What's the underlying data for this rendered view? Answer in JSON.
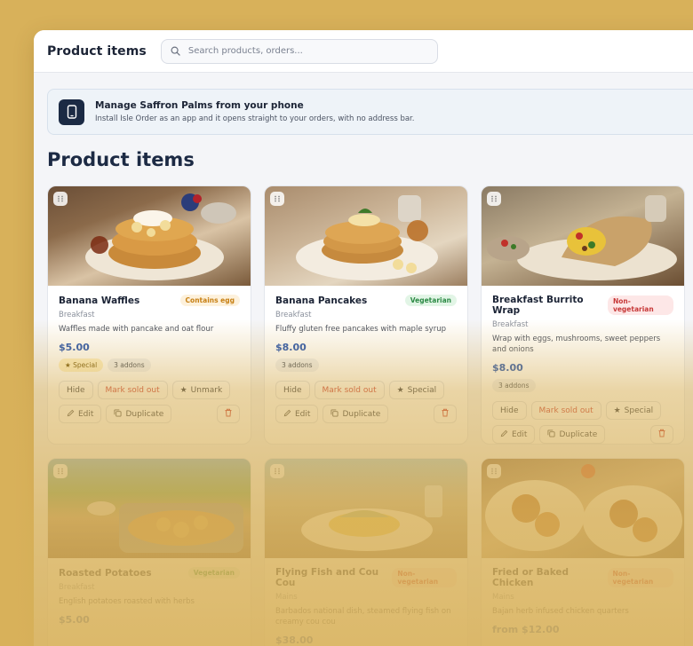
{
  "header": {
    "title": "Product items",
    "search_placeholder": "Search products, orders..."
  },
  "banner": {
    "title": "Manage Saffron Palms from your phone",
    "subtitle": "Install Isle Order as an app and it opens straight to your orders, with no address bar."
  },
  "page": {
    "title": "Product items"
  },
  "products": [
    {
      "name": "Banana Waffles",
      "tag": "Contains egg",
      "tag_type": "egg",
      "category": "Breakfast",
      "description": "Waffles made with pancake and oat flour",
      "price": "$5.00",
      "special_chip": "Special",
      "addons": "3 addons",
      "actions": {
        "hide": "Hide",
        "sold": "Mark sold out",
        "special": "Unmark",
        "edit": "Edit",
        "duplicate": "Duplicate"
      }
    },
    {
      "name": "Banana Pancakes",
      "tag": "Vegetarian",
      "tag_type": "veg",
      "category": "Breakfast",
      "description": "Fluffy gluten free pancakes with maple syrup",
      "price": "$8.00",
      "addons": "3 addons",
      "actions": {
        "hide": "Hide",
        "sold": "Mark sold out",
        "special": "Special",
        "edit": "Edit",
        "duplicate": "Duplicate"
      }
    },
    {
      "name": "Breakfast Burrito Wrap",
      "tag": "Non-vegetarian",
      "tag_type": "nonveg",
      "category": "Breakfast",
      "description": "Wrap with eggs, mushrooms, sweet peppers and onions",
      "price": "$8.00",
      "addons": "3 addons",
      "actions": {
        "hide": "Hide",
        "sold": "Mark sold out",
        "special": "Special",
        "edit": "Edit",
        "duplicate": "Duplicate"
      }
    },
    {
      "name": "Roasted Potatoes",
      "tag": "Vegetarian",
      "tag_type": "veg",
      "category": "Breakfast",
      "description": "English potatoes roasted with herbs",
      "price": "$5.00"
    },
    {
      "name": "Flying Fish and Cou Cou",
      "tag": "Non-vegetarian",
      "tag_type": "nonveg",
      "category": "Mains",
      "description": "Barbados national dish, steamed flying fish on creamy cou cou",
      "price": "$38.00"
    },
    {
      "name": "Fried or Baked Chicken",
      "tag": "Non-vegetarian",
      "tag_type": "nonveg",
      "category": "Mains",
      "description": "Bajan herb infused chicken quarters",
      "price": "from $12.00"
    }
  ],
  "colors": {
    "accent": "#1d4fb0",
    "background": "#d8b15a",
    "danger": "#c62f2f"
  }
}
